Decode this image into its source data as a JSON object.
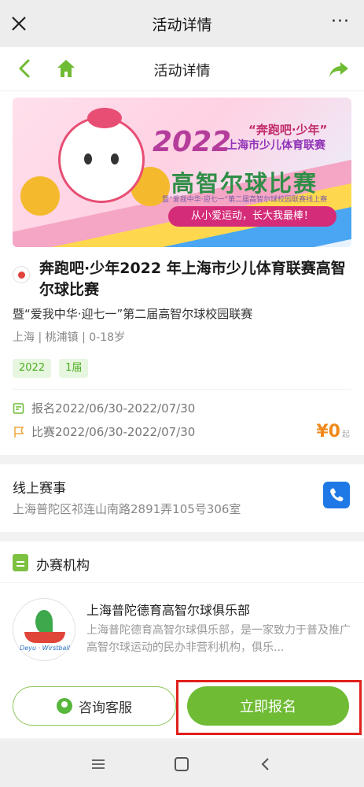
{
  "wechat_bar": {
    "title": "活动详情",
    "close_icon": "close-icon",
    "more_label": "···"
  },
  "page_nav": {
    "title": "活动详情",
    "back_icon": "chevron-left-icon",
    "home_icon": "home-icon",
    "share_icon": "share-arrow-icon"
  },
  "banner": {
    "year": "2022",
    "headline": "“奔跑吧·少年”",
    "league": "上海市少儿体育联赛",
    "main_title": "高智尔球比赛",
    "note": "暨“爱我中华·迎七一”第二届高智尔球校园联赛线上赛",
    "slogan": "从小爱运动，长大我最棒！"
  },
  "event": {
    "title": "奔跑吧·少年2022 年上海市少儿体育联赛高智尔球比赛",
    "subtitle": "暨“爱我中华·迎七一”第二届高智尔球校园联赛",
    "location": "上海 | 桃浦镇 | 0-18岁",
    "tags": [
      "2022",
      "1届"
    ],
    "signup_date": "报名2022/06/30-2022/07/30",
    "match_date": "比赛2022/06/30-2022/07/30",
    "price": "¥0",
    "price_suffix": "起"
  },
  "venue": {
    "title": "线上赛事",
    "address": "上海普陀区祁连山南路2891弄105号306室",
    "phone_icon": "phone-icon"
  },
  "organizer": {
    "section_title": "办赛机构",
    "name": "上海普陀德育高智尔球俱乐部",
    "description": "上海普陀德育高智尔球俱乐部，是一家致力于普及推广高智尔球运动的民办非营利机构，俱乐...",
    "logo_text": "Deyu · Wirstball"
  },
  "actions": {
    "consult_label": "咨询客服",
    "signup_label": "立即报名"
  },
  "colors": {
    "brand_green": "#6fbb34",
    "price_orange": "#f08a1c",
    "highlight_red": "#e0201b",
    "phone_blue": "#1e78e6"
  }
}
